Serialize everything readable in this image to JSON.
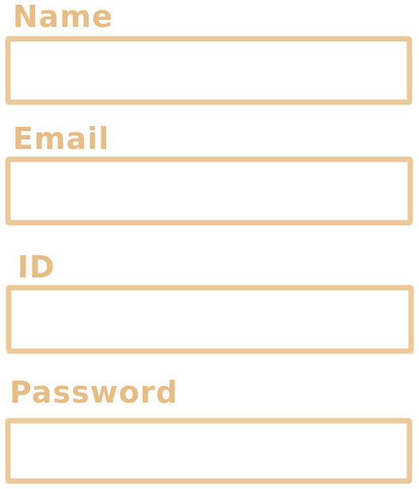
{
  "form": {
    "name": {
      "label": "Name",
      "value": "",
      "placeholder": ""
    },
    "email": {
      "label": "Email",
      "value": "",
      "placeholder": ""
    },
    "id": {
      "label": "ID",
      "value": "",
      "placeholder": ""
    },
    "password": {
      "label": "Password",
      "value": "",
      "placeholder": ""
    }
  },
  "colors": {
    "label_text": "#e6bd86",
    "field_border": "#ecc99a",
    "background": "#ffffff"
  }
}
